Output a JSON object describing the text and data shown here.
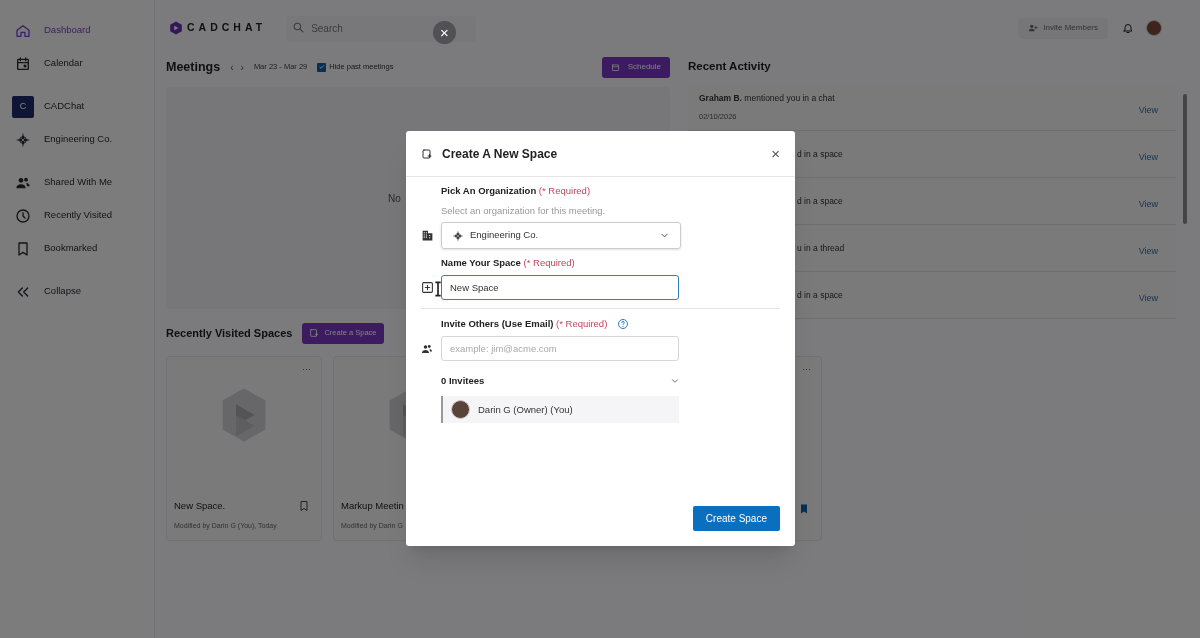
{
  "sidebar": {
    "items": [
      {
        "label": "Dashboard",
        "kind": "home",
        "selected": true
      },
      {
        "label": "Calendar",
        "kind": "calendar",
        "selected": false
      },
      {
        "label": "CADChat",
        "kind": "organization",
        "letter": "C",
        "selected": false
      },
      {
        "label": "Engineering Co.",
        "kind": "compass",
        "selected": false
      },
      {
        "label": "Shared With Me",
        "kind": "people",
        "selected": false
      },
      {
        "label": "Recently Visited",
        "kind": "clock",
        "selected": false
      },
      {
        "label": "Bookmarked",
        "kind": "bookmark",
        "selected": false
      },
      {
        "label": "Collapse",
        "kind": "collapse",
        "selected": false
      }
    ]
  },
  "header": {
    "logo": "CADCHAT",
    "search_placeholder": "Search",
    "invite_button": "Invite Members"
  },
  "overlay_close": "×",
  "meetings": {
    "title": "Meetings",
    "prev": "‹",
    "next": "›",
    "range": "Mar 23 - Mar 29",
    "hide_past": {
      "label": "Hide past meetings",
      "checked": true
    },
    "schedule_button": "Schedule",
    "empty_text": "No"
  },
  "recent_spaces": {
    "title": "Recently Visited Spaces",
    "create_button": "Create a Space",
    "cards": [
      {
        "title": "New Space.",
        "meta": "Modified by Darin G (You), Today",
        "menu": "···",
        "bookmarked": false
      },
      {
        "title": "Markup Meetin",
        "meta": "Modified by Darin G"
      },
      {
        "menu": "···",
        "bookmarked": true
      }
    ]
  },
  "recent_activity": {
    "title": "Recent Activity",
    "items": [
      {
        "actor": "Graham B.",
        "text": "mentioned you in a chat",
        "date": "02/10/2026",
        "link": "View"
      },
      {
        "text": "d in a space",
        "link": "View"
      },
      {
        "text": "d in a space",
        "link": "View"
      },
      {
        "text": "u in a thread",
        "link": "View"
      },
      {
        "text": "d in a space",
        "link": "View"
      }
    ]
  },
  "dialog": {
    "title": "Create A New Space",
    "close": "×",
    "org": {
      "label": "Pick An Organization",
      "required": "(* Required)",
      "hint": "Select an organization for this meeting.",
      "value": "Engineering Co."
    },
    "name": {
      "label": "Name Your Space",
      "required": "(* Required)",
      "value": "New Space"
    },
    "invite": {
      "label": "Invite Others (Use Email)",
      "required": "(* Required)",
      "placeholder": "example: jim@acme.com"
    },
    "invitees": {
      "title": "0 Invitees",
      "people": [
        {
          "name": "Darin G (Owner) (You)"
        }
      ]
    },
    "submit": "Create Space"
  }
}
